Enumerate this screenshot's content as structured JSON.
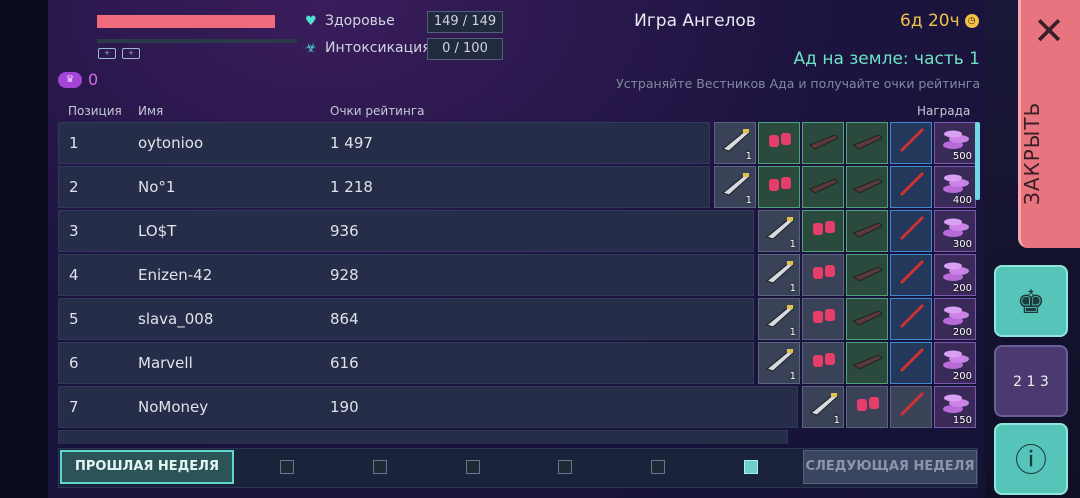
{
  "status": {
    "health_label": "Здоровье",
    "health_value": "149 / 149",
    "toxicity_label": "Интоксикация",
    "toxicity_value": "0 / 100",
    "health_fraction": 1.0,
    "crowns": "0"
  },
  "event": {
    "title": "Игра Ангелов",
    "timer": "6д 20ч",
    "subtitle": "Ад на земле: часть 1",
    "description": "Устраняйте Вестников Ада и получайте очки рейтинга"
  },
  "columns": {
    "position": "Позиция",
    "name": "Имя",
    "score": "Очки рейтинга",
    "reward": "Награда"
  },
  "rows": [
    {
      "position": "1",
      "name": "oytonioo",
      "score": "1 497",
      "coins": "500",
      "first_qty": "1",
      "reward_count": 6
    },
    {
      "position": "2",
      "name": "No°1",
      "score": "1 218",
      "coins": "400",
      "first_qty": "1",
      "reward_count": 6
    },
    {
      "position": "3",
      "name": "LO$T",
      "score": "936",
      "coins": "300",
      "first_qty": "1",
      "reward_count": 5
    },
    {
      "position": "4",
      "name": "Enizen-42",
      "score": "928",
      "coins": "200",
      "first_qty": "1",
      "reward_count": 5
    },
    {
      "position": "5",
      "name": "slava_008",
      "score": "864",
      "coins": "200",
      "first_qty": "1",
      "reward_count": 5
    },
    {
      "position": "6",
      "name": "Marvell",
      "score": "616",
      "coins": "200",
      "first_qty": "1",
      "reward_count": 5
    },
    {
      "position": "7",
      "name": "NoMoney",
      "score": "190",
      "coins": "150",
      "first_qty": "1",
      "reward_count": 4
    }
  ],
  "footer": {
    "prev_week": "ПРОШЛАЯ НЕДЕЛЯ",
    "next_week": "СЛЕДУЮЩАЯ НЕДЕЛЯ",
    "active_page_index": 5
  },
  "side": {
    "close_label": "ЗАКРЫТЬ",
    "podium": [
      "2",
      "1",
      "3"
    ]
  }
}
